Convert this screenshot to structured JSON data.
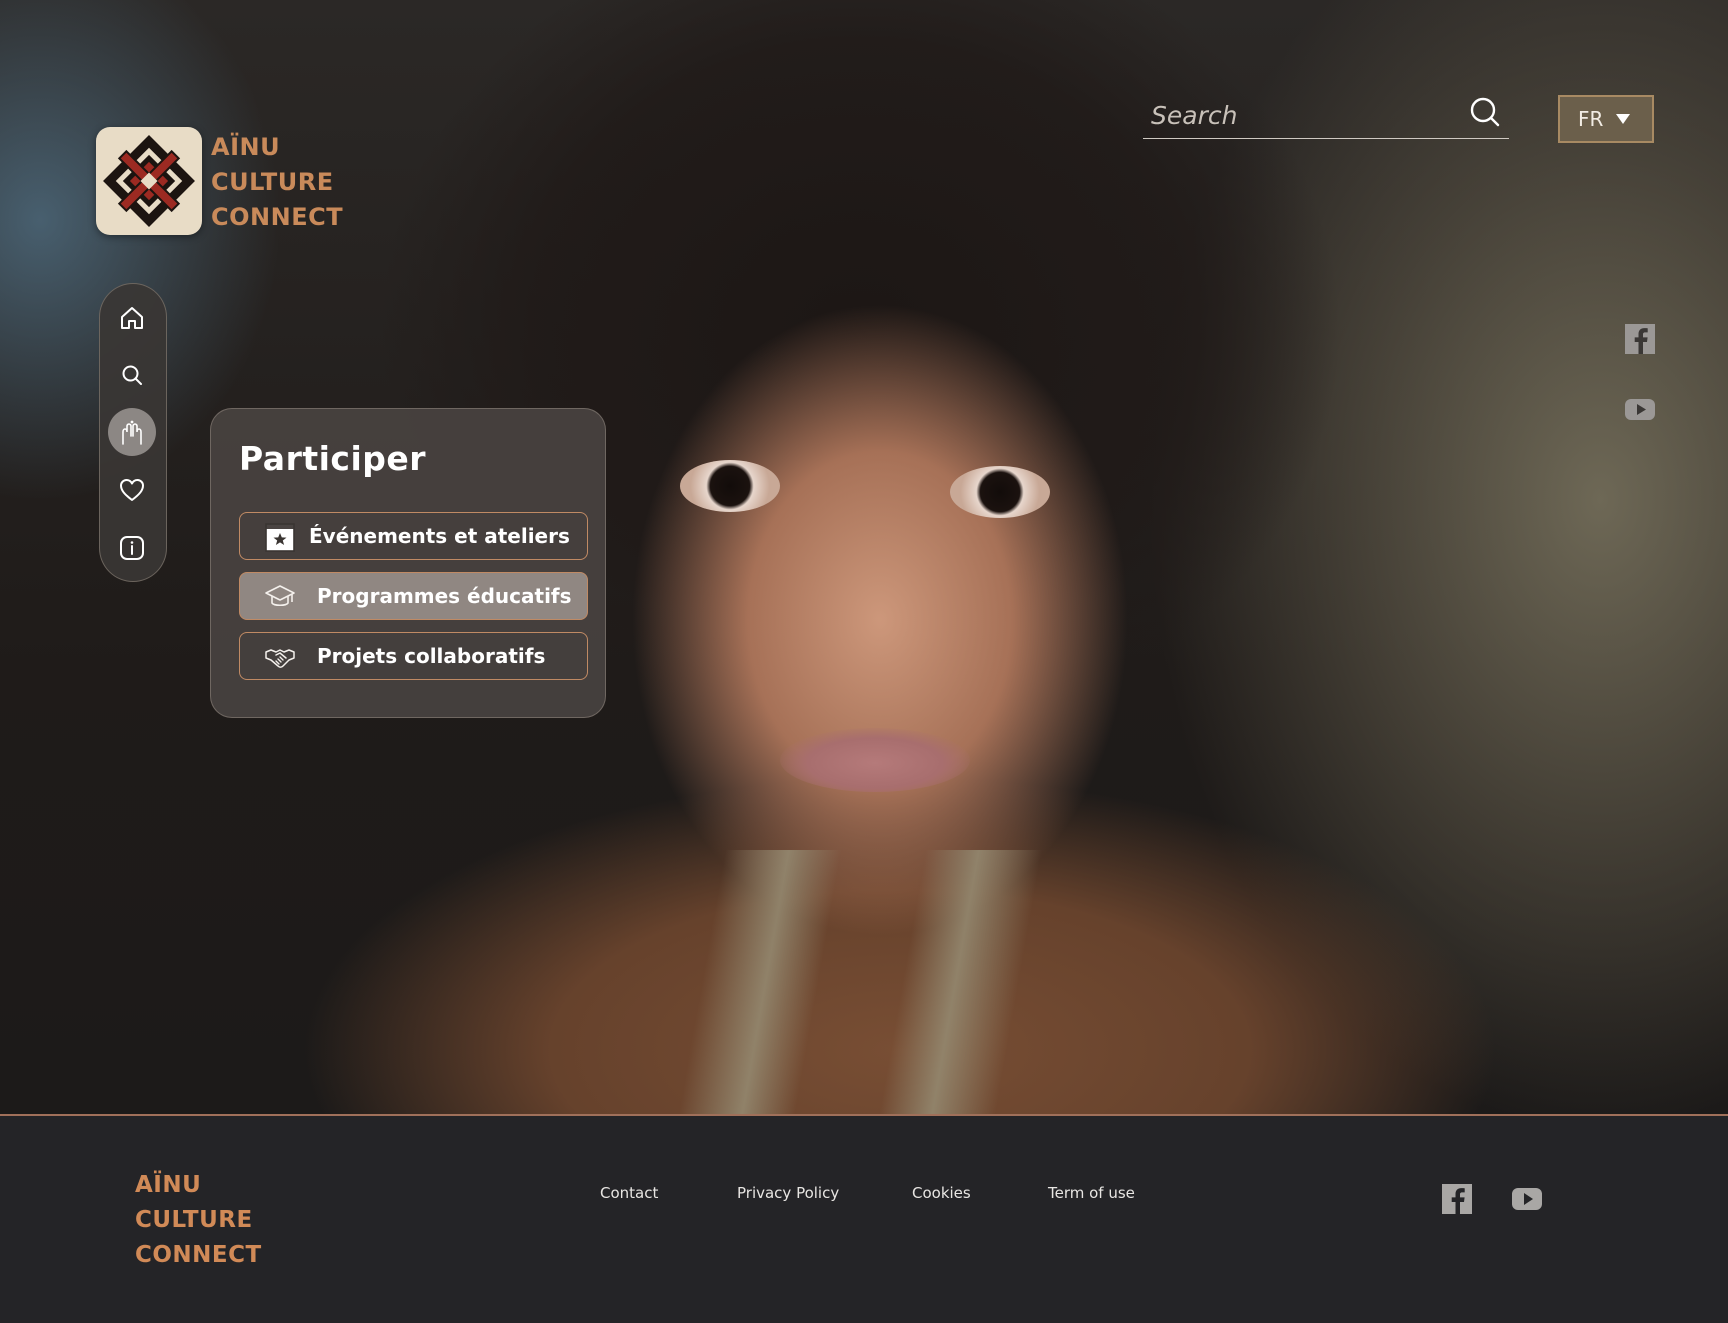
{
  "brand": {
    "name_lines": [
      "AÏNU",
      "CULTURE",
      "CONNECT"
    ],
    "accent_color": "#c98a5a"
  },
  "header": {
    "search": {
      "placeholder": "Search"
    },
    "language": {
      "selected": "FR"
    }
  },
  "side_nav": {
    "items": [
      {
        "icon": "home-icon"
      },
      {
        "icon": "search-icon"
      },
      {
        "icon": "hands-icon",
        "active": true
      },
      {
        "icon": "heart-icon"
      },
      {
        "icon": "info-icon"
      }
    ]
  },
  "panel": {
    "title": "Participer",
    "items": [
      {
        "label": "Événements et ateliers",
        "icon": "calendar-star-icon"
      },
      {
        "label": "Programmes éducatifs",
        "icon": "graduation-cap-icon",
        "selected": true
      },
      {
        "label": "Projets collaboratifs",
        "icon": "handshake-icon"
      }
    ]
  },
  "social": [
    "facebook-icon",
    "youtube-icon"
  ],
  "footer": {
    "logo_lines": [
      "AÏNU",
      "CULTURE",
      "CONNECT"
    ],
    "links": [
      "Contact",
      "Privacy Policy",
      "Cookies",
      "Term of use"
    ]
  }
}
